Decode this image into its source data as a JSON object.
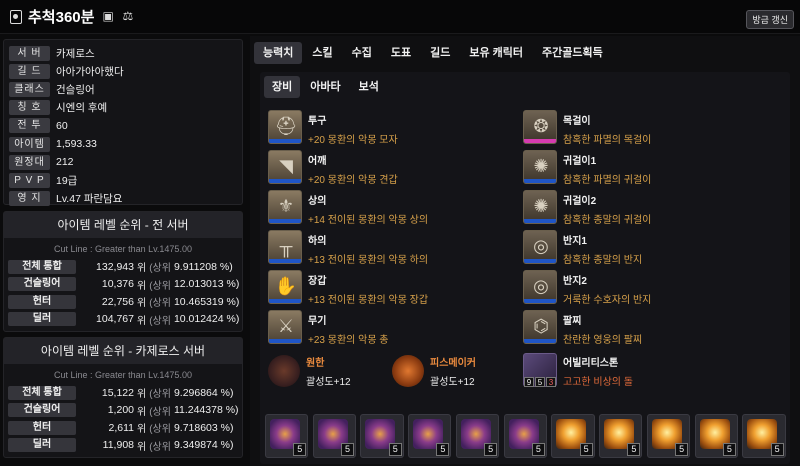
{
  "header": {
    "title": "추척360분",
    "refresh_label": "방금 갱신"
  },
  "info": [
    {
      "label": "서 버",
      "value": "카제로스"
    },
    {
      "label": "길 드",
      "value": "아아가아아했다"
    },
    {
      "label": "클래스",
      "value": "건슬링어"
    },
    {
      "label": "칭 호",
      "value": "시엔의 후예"
    },
    {
      "label": "전 투",
      "value": "60"
    },
    {
      "label": "아이템",
      "value": "1,593.33"
    },
    {
      "label": "원정대",
      "value": "212"
    },
    {
      "label": "P V P",
      "value": "19급"
    },
    {
      "label": "영 지",
      "value": "Lv.47 파란담요"
    }
  ],
  "ranking_all": {
    "title": "아이템 레벨 순위 - 전 서버",
    "cutline": "Cut Line : Greater than Lv.1475.00",
    "rows": [
      {
        "label": "전체 통합",
        "rank": "132,943",
        "unit": "위",
        "upper": "(상위",
        "pct": "9.911208 %)"
      },
      {
        "label": "건슬링어",
        "rank": "10,376",
        "unit": "위",
        "upper": "(상위",
        "pct": "12.013013 %)"
      },
      {
        "label": "헌터",
        "rank": "22,756",
        "unit": "위",
        "upper": "(상위",
        "pct": "10.465319 %)"
      },
      {
        "label": "딜러",
        "rank": "104,767",
        "unit": "위",
        "upper": "(상위",
        "pct": "10.012424 %)"
      }
    ]
  },
  "ranking_server": {
    "title": "아이템 레벨 순위 - 카제로스 서버",
    "cutline": "Cut Line : Greater than Lv.1475.00",
    "rows": [
      {
        "label": "전체 통합",
        "rank": "15,122",
        "unit": "위",
        "upper": "(상위",
        "pct": "9.296864 %)"
      },
      {
        "label": "건슬링어",
        "rank": "1,200",
        "unit": "위",
        "upper": "(상위",
        "pct": "11.244378 %)"
      },
      {
        "label": "헌터",
        "rank": "2,611",
        "unit": "위",
        "upper": "(상위",
        "pct": "9.718603 %)"
      },
      {
        "label": "딜러",
        "rank": "11,908",
        "unit": "위",
        "upper": "(상위",
        "pct": "9.349874 %)"
      }
    ]
  },
  "tabs": [
    "능력치",
    "스킬",
    "수집",
    "도표",
    "길드",
    "보유 캐릭터",
    "주간골드획득"
  ],
  "subtabs": [
    "장비",
    "아바타",
    "보석"
  ],
  "equipment_left": [
    {
      "name": "투구",
      "desc": "+20 몽환의 악몽 모자",
      "icon": "helmet-icon"
    },
    {
      "name": "어깨",
      "desc": "+20 몽환의 악몽 견갑",
      "icon": "shoulder-icon"
    },
    {
      "name": "상의",
      "desc": "+14 전이된 몽환의 악몽 상의",
      "icon": "chest-icon"
    },
    {
      "name": "하의",
      "desc": "+13 전이된 몽환의 악몽 하의",
      "icon": "pants-icon"
    },
    {
      "name": "장갑",
      "desc": "+13 전이된 몽환의 악몽 장갑",
      "icon": "gloves-icon"
    },
    {
      "name": "무기",
      "desc": "+23 몽환의 악몽 총",
      "icon": "weapon-icon"
    }
  ],
  "equipment_right": [
    {
      "name": "목걸이",
      "desc": "참혹한 파멸의 목걸이",
      "icon": "necklace-icon"
    },
    {
      "name": "귀걸이1",
      "desc": "참혹한 파멸의 귀걸이",
      "icon": "earring-icon"
    },
    {
      "name": "귀걸이2",
      "desc": "참혹한 종말의 귀걸이",
      "icon": "earring-icon"
    },
    {
      "name": "반지1",
      "desc": "참혹한 종말의 반지",
      "icon": "ring-icon"
    },
    {
      "name": "반지2",
      "desc": "거룩한 수호자의 반지",
      "icon": "ring-icon"
    },
    {
      "name": "팔찌",
      "desc": "찬란한 영웅의 팔찌",
      "icon": "bracelet-icon"
    }
  ],
  "engravings": [
    {
      "name": "원한",
      "sub": "괄성도+12"
    },
    {
      "name": "피스메이커",
      "sub": "괄성도+12"
    }
  ],
  "ability_stone": {
    "name": "어빌리티스톤",
    "desc": "고고한 비상의 돌",
    "badges": [
      "9",
      "5",
      "3"
    ]
  },
  "jewels": [
    {
      "type": "purple",
      "level": "5"
    },
    {
      "type": "purple",
      "level": "5"
    },
    {
      "type": "purple",
      "level": "5"
    },
    {
      "type": "purple",
      "level": "5"
    },
    {
      "type": "purple",
      "level": "5"
    },
    {
      "type": "purple",
      "level": "5"
    },
    {
      "type": "orange",
      "level": "5"
    },
    {
      "type": "orange",
      "level": "5"
    },
    {
      "type": "orange",
      "level": "5"
    },
    {
      "type": "orange",
      "level": "5"
    },
    {
      "type": "orange",
      "level": "5"
    }
  ]
}
